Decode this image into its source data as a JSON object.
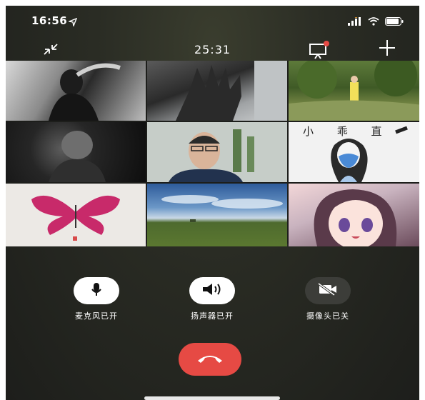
{
  "status_bar": {
    "time": "16:56"
  },
  "call": {
    "duration": "25:31"
  },
  "tiles": [
    {
      "id": "tile-1"
    },
    {
      "id": "tile-2"
    },
    {
      "id": "tile-3"
    },
    {
      "id": "tile-4"
    },
    {
      "id": "tile-5"
    },
    {
      "id": "tile-6",
      "caption": "小 乖 直"
    },
    {
      "id": "tile-7"
    },
    {
      "id": "tile-8"
    },
    {
      "id": "tile-9"
    }
  ],
  "controls": {
    "mic_label": "麦克风已开",
    "speaker_label": "扬声器已开",
    "camera_label": "摄像头已关"
  },
  "colors": {
    "hangup": "#e64a44",
    "notification_dot": "#e64a44"
  }
}
